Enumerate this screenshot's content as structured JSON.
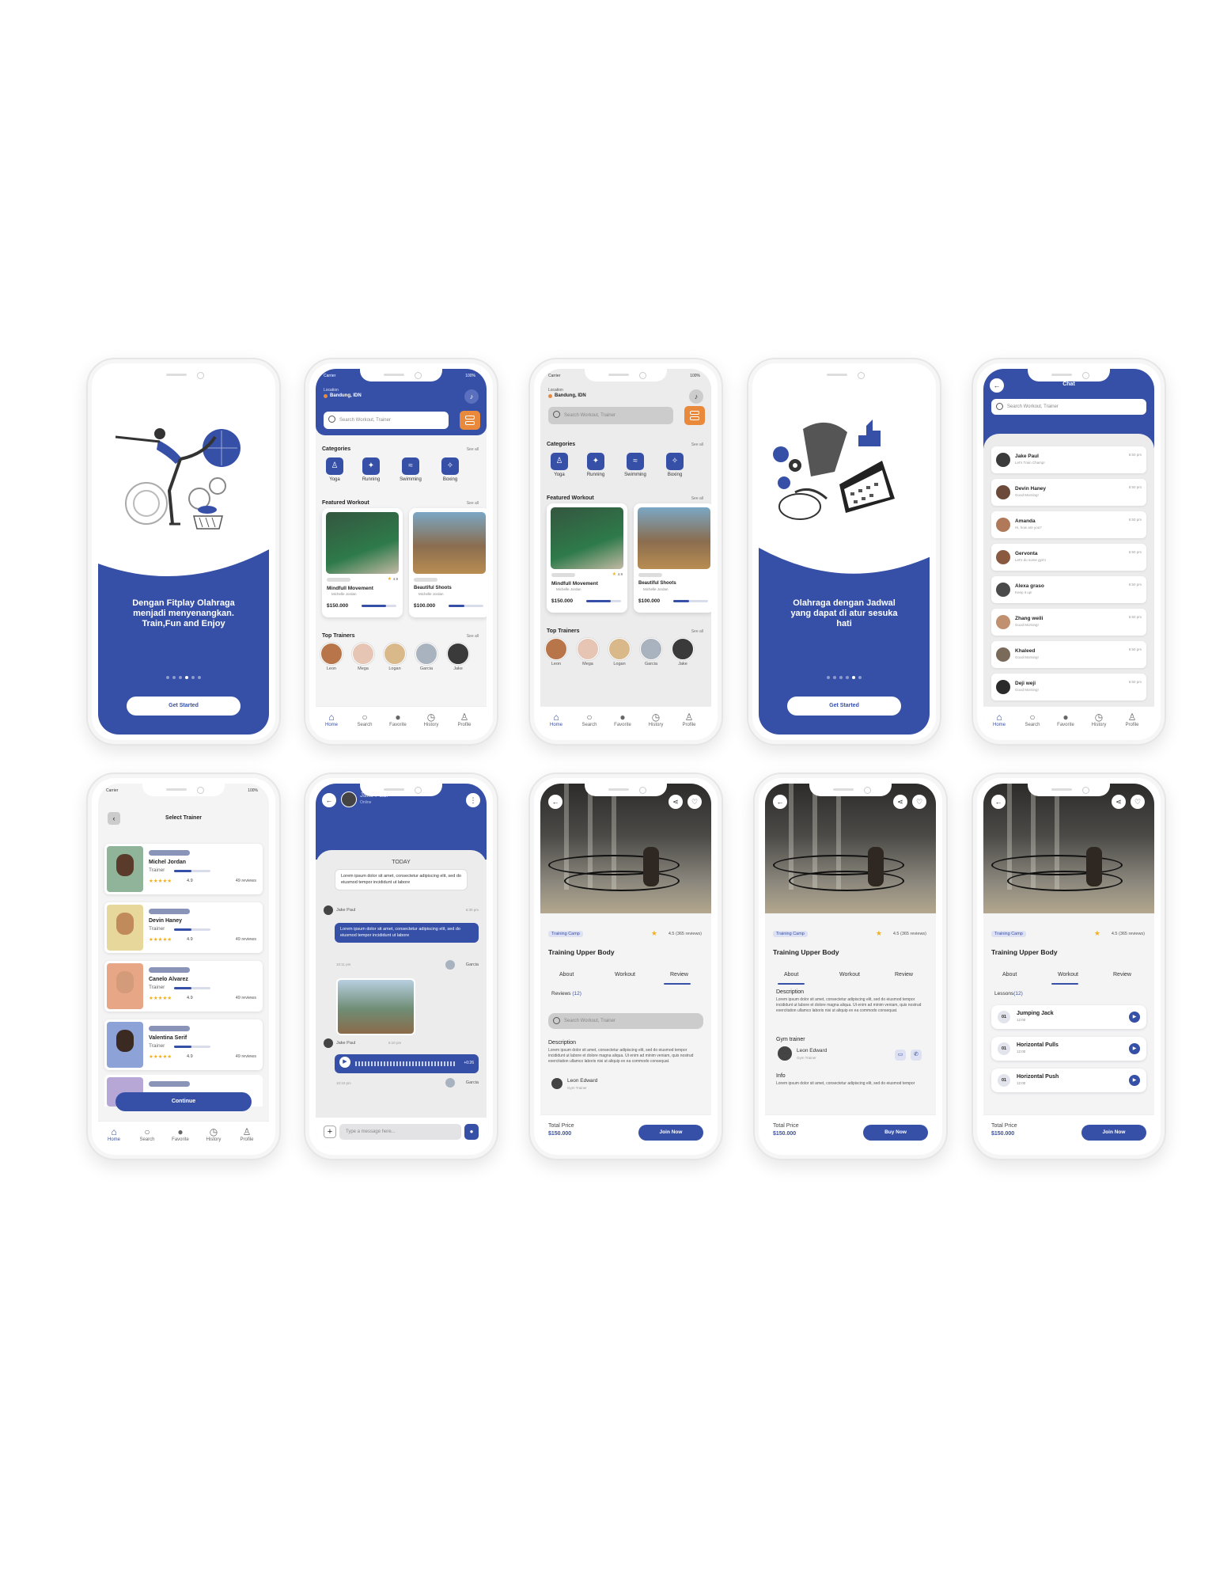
{
  "colors": {
    "primary": "#3650a8",
    "accent": "#e8893c",
    "star": "#f2b01e"
  },
  "status": {
    "carrier": "Carrier",
    "battery": "100%"
  },
  "onboard1": {
    "text": "Dengan Fitplay Olahraga menjadi menyenangkan. Train,Fun and Enjoy",
    "button": "Get Started"
  },
  "onboard2": {
    "text": "Olahraga dengan Jadwal yang dapat di atur sesuka hati",
    "button": "Get Started"
  },
  "home": {
    "location_label": "Location",
    "location": "Bandung, IDN",
    "search_placeholder": "Search Workout, Trainer",
    "categories_title": "Categories",
    "see_all": "See all",
    "categories": [
      "Yoga",
      "Running",
      "Swimming",
      "Boxing"
    ],
    "featured_title": "Featured Workout",
    "featured": [
      {
        "title": "Mindfull Movement",
        "trainer": "Michelle Jordan",
        "price": "$150.000",
        "rating": "4.9"
      },
      {
        "title": "Beautiful Shoots",
        "trainer": "Michelle Jordan",
        "price": "$100.000"
      }
    ],
    "trainers_title": "Top Trainers",
    "trainers": [
      "Leon",
      "Mega",
      "Logan",
      "Garcia",
      "Jake"
    ]
  },
  "nav": [
    "Home",
    "Search",
    "Favorite",
    "History",
    "Profile"
  ],
  "chat_list": {
    "title": "Chat",
    "search_placeholder": "Search Workout, Trainer",
    "items": [
      {
        "name": "Jake Paul",
        "msg": "Let's Train Champ!",
        "time": "6:50 pm"
      },
      {
        "name": "Devin Haney",
        "msg": "Good Morning!",
        "time": "6:50 pm"
      },
      {
        "name": "Amanda",
        "msg": "Hi, how are you?",
        "time": "6:50 pm"
      },
      {
        "name": "Gervonta",
        "msg": "Let's do some gym!",
        "time": "6:50 pm"
      },
      {
        "name": "Alexa graso",
        "msg": "Keep it up!",
        "time": "6:50 pm"
      },
      {
        "name": "Zhang weili",
        "msg": "Good Morning!",
        "time": "6:50 pm"
      },
      {
        "name": "Khaleed",
        "msg": "Good Morning!",
        "time": "6:50 pm"
      },
      {
        "name": "Deji weji",
        "msg": "Good Morning!",
        "time": "6:50 pm"
      }
    ]
  },
  "select_trainer": {
    "title": "Select Trainer",
    "role": "Trainer",
    "rating": "4.9",
    "reviews": "49 reviews",
    "button": "Continue",
    "names": [
      "Michel Jordan",
      "Devin Haney",
      "Canelo Alvarez",
      "Valentina Serif"
    ]
  },
  "chat": {
    "name": "Jake Paul",
    "status": "Online",
    "today": "TODAY",
    "msg1": "Lorem ipsum dolor sit amet, consectetur adipiscing elit, sed do eiusmod tempor incididunt ut labore",
    "who1": "Jake Paul",
    "time1": "6:30 pm",
    "msg2": "Lorem ipsum dolor sit amet, consectetur adipiscing elit, sed do eiusmod tempor incididunt ut labore",
    "who2": "Garcia",
    "time2": "10:11 pm",
    "who3": "Jake Paul",
    "time3": "6:10 pm",
    "voice_time": "+0:26",
    "who4": "Garcia",
    "time4": "10:10 pm",
    "placeholder": "Type a message here..."
  },
  "detail": {
    "tag": "Training Camp",
    "rating": "4.5 (365 reviews)",
    "title": "Training Upper Body",
    "tabs": [
      "About",
      "Workout",
      "Review"
    ],
    "reviews_label": "Reviews",
    "reviews_count": "(12)",
    "search_placeholder": "Search Workout, Trainer",
    "description_title": "Description",
    "description": "Lorem ipsum dolor sit amet, consectetur adipiscing elit, sed do eiusmod tempor incididunt ut labore et dolore magna aliqua. Ut enim ad minim veniam, quis nostrud exercitation ullamco laboris nisi ut aliquip ex ea commodo consequat.",
    "trainer_name": "Leon Edward",
    "trainer_role": "Gym Trainer",
    "gym_trainer_label": "Gym trainer",
    "info_label": "Info",
    "total_label": "Total Price",
    "total": "$150.000",
    "join": "Join Now",
    "buy": "Buy Now",
    "lessons_label": "Lessons",
    "lessons_count": "(12)",
    "lessons": [
      {
        "num": "01",
        "title": "Jumping Jack",
        "dur": "12:00"
      },
      {
        "num": "01",
        "title": "Horizontal Pulls",
        "dur": "12:00"
      },
      {
        "num": "01",
        "title": "Horizontal Push",
        "dur": "12:00"
      }
    ]
  }
}
